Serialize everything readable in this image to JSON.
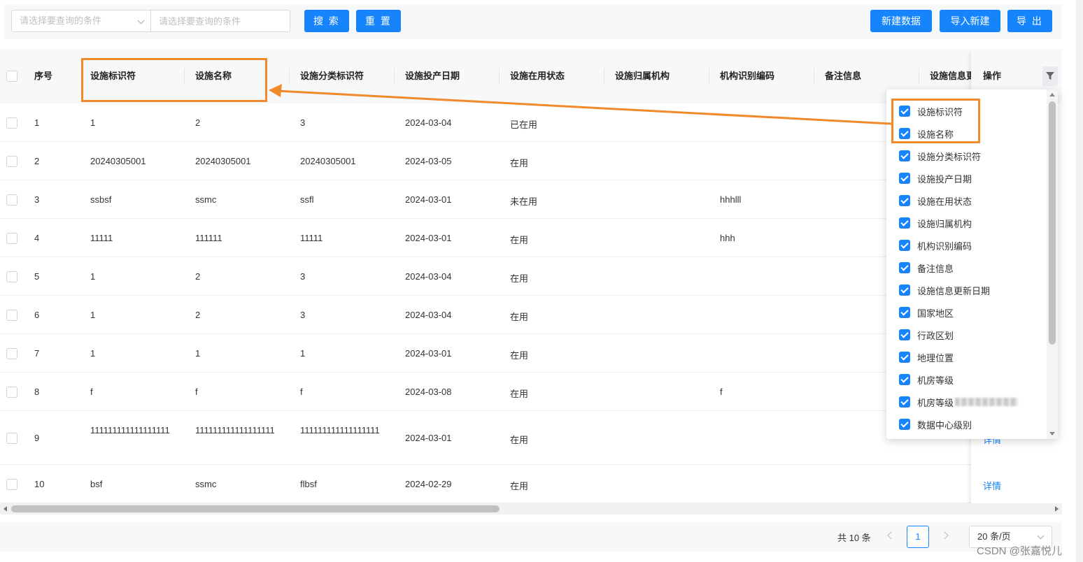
{
  "search": {
    "condition_select_placeholder": "请选择要查询的条件",
    "condition_input_placeholder": "请选择要查询的条件"
  },
  "toolbar": {
    "search_label": "搜 索",
    "reset_label": "重 置",
    "create_label": "新建数据",
    "import_label": "导入新建",
    "export_label": "导 出"
  },
  "table": {
    "columns": {
      "index": "序号",
      "facility_id": "设施标识符",
      "facility_name": "设施名称",
      "category_id": "设施分类标识符",
      "commission_date": "设施投产日期",
      "usage_status": "设施在用状态",
      "owner_org": "设施归属机构",
      "org_code": "机构识别编码",
      "remarks": "备注信息",
      "update_date": "设施信息更新日期",
      "actions": "操作"
    },
    "rows": [
      {
        "index": "1",
        "facility_id": "1",
        "facility_name": "2",
        "category_id": "3",
        "commission_date": "2024-03-04",
        "usage_status": "已在用",
        "org_code": "",
        "action": ""
      },
      {
        "index": "2",
        "facility_id": "20240305001",
        "facility_name": "20240305001",
        "category_id": "20240305001",
        "commission_date": "2024-03-05",
        "usage_status": "在用",
        "org_code": "",
        "action": ""
      },
      {
        "index": "3",
        "facility_id": "ssbsf",
        "facility_name": "ssmc",
        "category_id": "ssfl",
        "commission_date": "2024-03-01",
        "usage_status": "未在用",
        "org_code": "hhhlll",
        "action": ""
      },
      {
        "index": "4",
        "facility_id": "11111",
        "facility_name": "111111",
        "category_id": "11111",
        "commission_date": "2024-03-01",
        "usage_status": "在用",
        "org_code": "hhh",
        "action": ""
      },
      {
        "index": "5",
        "facility_id": "1",
        "facility_name": "2",
        "category_id": "3",
        "commission_date": "2024-03-04",
        "usage_status": "在用",
        "org_code": "",
        "action": ""
      },
      {
        "index": "6",
        "facility_id": "1",
        "facility_name": "2",
        "category_id": "3",
        "commission_date": "2024-03-04",
        "usage_status": "在用",
        "org_code": "",
        "action": ""
      },
      {
        "index": "7",
        "facility_id": "1",
        "facility_name": "1",
        "category_id": "1",
        "commission_date": "2024-03-01",
        "usage_status": "在用",
        "org_code": "",
        "action": ""
      },
      {
        "index": "8",
        "facility_id": "f",
        "facility_name": "f",
        "category_id": "f",
        "commission_date": "2024-03-08",
        "usage_status": "在用",
        "org_code": "f",
        "action": ""
      },
      {
        "index": "9",
        "facility_id": "111111111111111111",
        "facility_name": "111111111111111111",
        "category_id": "111111111111111111",
        "commission_date": "2024-03-01",
        "usage_status": "在用",
        "org_code": "",
        "action": "详情"
      },
      {
        "index": "10",
        "facility_id": "bsf",
        "facility_name": "ssmc",
        "category_id": "flbsf",
        "commission_date": "2024-02-29",
        "usage_status": "在用",
        "org_code": "",
        "action": "详情"
      }
    ]
  },
  "column_picker": {
    "items": [
      {
        "label": "设施标识符",
        "checked": true
      },
      {
        "label": "设施名称",
        "checked": true
      },
      {
        "label": "设施分类标识符",
        "checked": true
      },
      {
        "label": "设施投产日期",
        "checked": true
      },
      {
        "label": "设施在用状态",
        "checked": true
      },
      {
        "label": "设施归属机构",
        "checked": true
      },
      {
        "label": "机构识别编码",
        "checked": true
      },
      {
        "label": "备注信息",
        "checked": true
      },
      {
        "label": "设施信息更新日期",
        "checked": true
      },
      {
        "label": "国家地区",
        "checked": true
      },
      {
        "label": "行政区划",
        "checked": true
      },
      {
        "label": "地理位置",
        "checked": true
      },
      {
        "label": "机房等级",
        "checked": true
      },
      {
        "label": "机房等级",
        "checked": true,
        "blurred_suffix": true
      },
      {
        "label": "数据中心级别",
        "checked": true
      }
    ]
  },
  "pagination": {
    "total_text": "共 10 条",
    "current_page": "1",
    "page_size_text": "20 条/页"
  },
  "watermark": "CSDN @张嘉悦儿",
  "colors": {
    "primary": "#1684fc",
    "annotation": "#f08a2a",
    "header_bg": "#f7f8fa"
  }
}
